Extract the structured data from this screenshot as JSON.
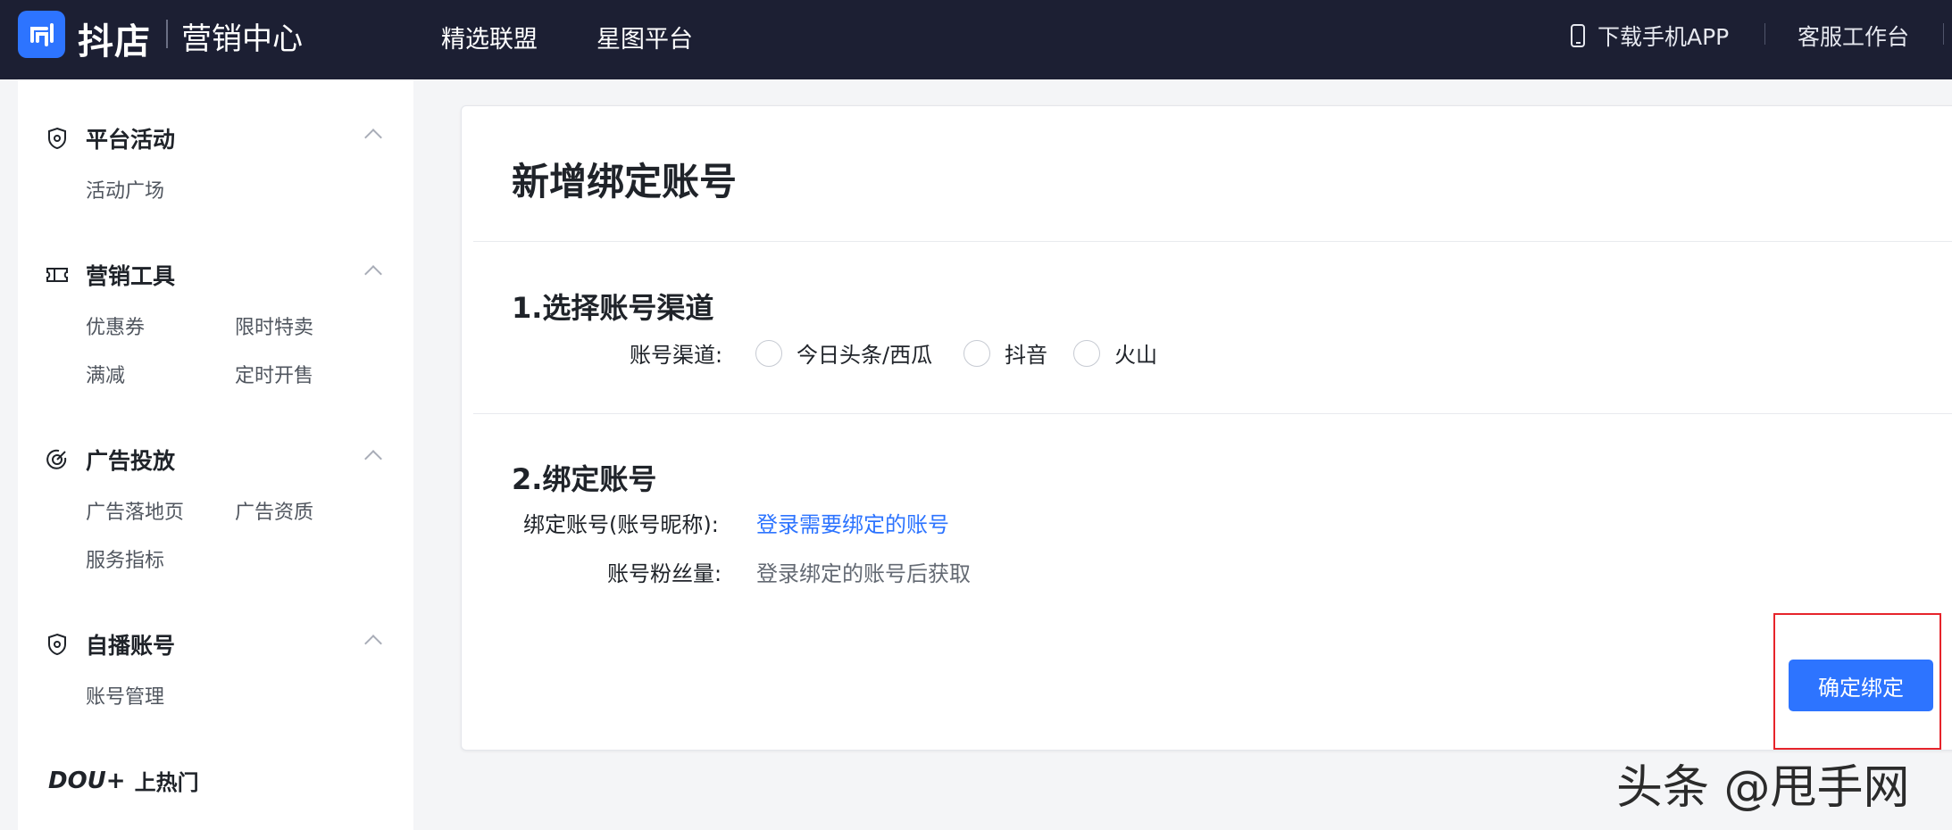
{
  "topbar": {
    "logo_text": "抖店",
    "app_title": "营销中心",
    "nav": [
      "精选联盟",
      "星图平台"
    ],
    "download_app": "下载手机APP",
    "service": "客服工作台"
  },
  "sidebar": {
    "groups": [
      {
        "title": "平台活动",
        "icon": "shield-icon",
        "items": [
          "活动广场"
        ]
      },
      {
        "title": "营销工具",
        "icon": "ticket-icon",
        "items": [
          "优惠券",
          "限时特卖",
          "满减",
          "定时开售"
        ]
      },
      {
        "title": "广告投放",
        "icon": "target-icon",
        "items": [
          "广告落地页",
          "广告资质",
          "服务指标"
        ]
      },
      {
        "title": "自播账号",
        "icon": "shield-icon",
        "items": [
          "账号管理"
        ]
      }
    ],
    "dou_brand": "DOU+",
    "dou_text": "上热门"
  },
  "main": {
    "title": "新增绑定账号",
    "section1": {
      "title": "1.选择账号渠道",
      "label": "账号渠道:",
      "options": [
        "今日头条/西瓜",
        "抖音",
        "火山"
      ]
    },
    "section2": {
      "title": "2.绑定账号",
      "bind_label": "绑定账号(账号昵称):",
      "bind_link": "登录需要绑定的账号",
      "fans_label": "账号粉丝量:",
      "fans_value": "登录绑定的账号后获取"
    },
    "confirm_button": "确定绑定"
  },
  "watermark": "头条 @甩手网",
  "colors": {
    "topbar_bg": "#1c1f33",
    "accent": "#2d74ff",
    "highlight": "#e6242b"
  }
}
